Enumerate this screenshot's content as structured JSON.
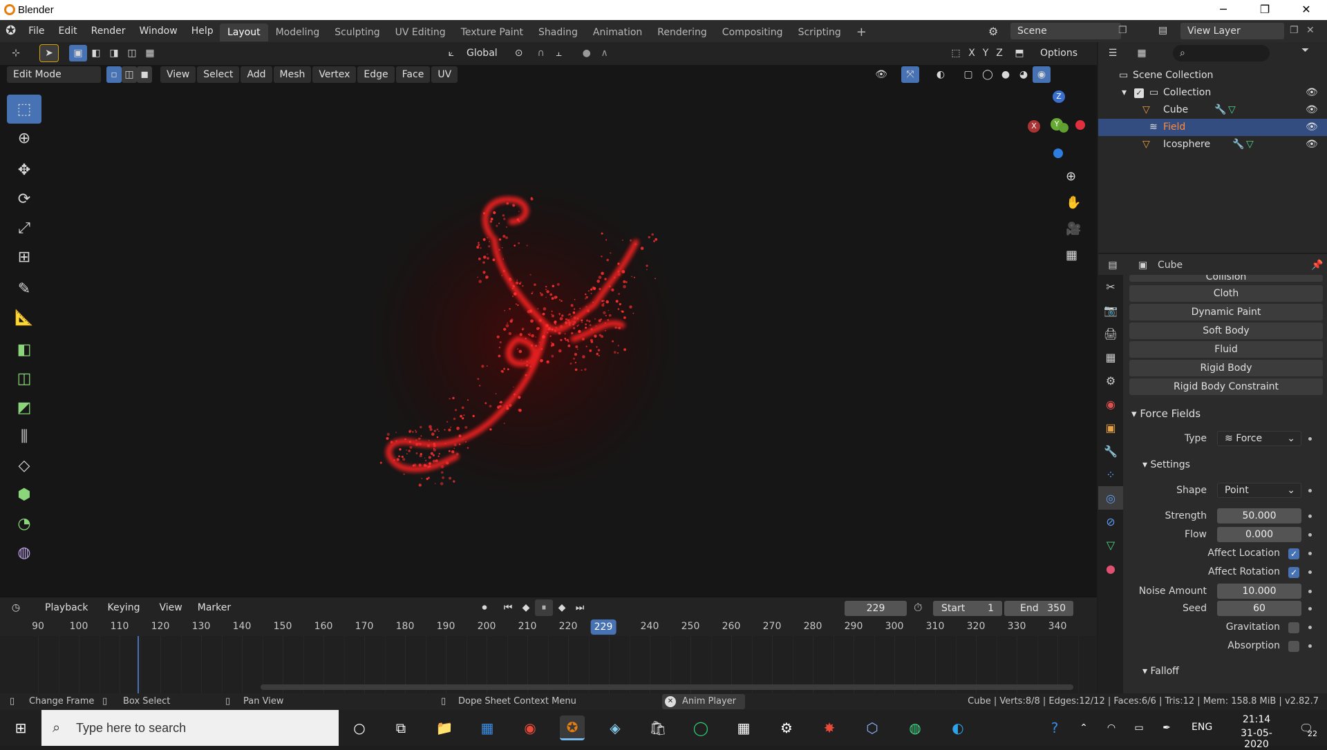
{
  "window": {
    "title": "Blender",
    "controls": [
      "─",
      "❐",
      "✕"
    ]
  },
  "menus": [
    "File",
    "Edit",
    "Render",
    "Window",
    "Help"
  ],
  "workspaces": [
    "Layout",
    "Modeling",
    "Sculpting",
    "UV Editing",
    "Texture Paint",
    "Shading",
    "Animation",
    "Rendering",
    "Compositing",
    "Scripting"
  ],
  "active_workspace": "Layout",
  "add_workspace": "+",
  "scene": "Scene",
  "view_layer": "View Layer",
  "viewport": {
    "orientation": "Global",
    "axes": [
      "X",
      "Y",
      "Z"
    ],
    "options": "Options",
    "mode": "Edit Mode",
    "header_menus": [
      "View",
      "Select",
      "Add",
      "Mesh",
      "Vertex",
      "Edge",
      "Face",
      "UV"
    ],
    "gizmo_axes": {
      "x": "X",
      "y": "Y",
      "z": "Z"
    },
    "particle_color": "#ff1a1a"
  },
  "timeline": {
    "menus": [
      "Playback",
      "Keying",
      "View",
      "Marker"
    ],
    "current_frame": "229",
    "start_label": "Start",
    "start": "1",
    "end_label": "End",
    "end": "350",
    "ticks": [
      "90",
      "100",
      "110",
      "120",
      "130",
      "140",
      "150",
      "160",
      "170",
      "180",
      "190",
      "200",
      "210",
      "220",
      "240",
      "250",
      "260",
      "270",
      "280",
      "290",
      "300",
      "310",
      "320",
      "330",
      "340"
    ]
  },
  "outliner": {
    "root": "Scene Collection",
    "collection": "Collection",
    "items": [
      {
        "name": "Cube",
        "selected": false
      },
      {
        "name": "Field",
        "selected": true
      },
      {
        "name": "Icosphere",
        "selected": false
      }
    ]
  },
  "properties": {
    "object_name": "Cube",
    "partial_button": "Collision",
    "physics_buttons": [
      "Cloth",
      "Dynamic Paint",
      "Soft Body",
      "Fluid",
      "Rigid Body",
      "Rigid Body Constraint"
    ],
    "force_fields": {
      "section": "Force Fields",
      "type_label": "Type",
      "type": "Force",
      "settings_label": "Settings",
      "shape_label": "Shape",
      "shape": "Point",
      "strength_label": "Strength",
      "strength": "50.000",
      "flow_label": "Flow",
      "flow": "0.000",
      "affect_location_label": "Affect Location",
      "affect_location": true,
      "affect_rotation_label": "Affect Rotation",
      "affect_rotation": true,
      "noise_label": "Noise Amount",
      "noise": "10.000",
      "seed_label": "Seed",
      "seed": "60",
      "gravitation_label": "Gravitation",
      "gravitation": false,
      "absorption_label": "Absorption",
      "absorption": false,
      "falloff_label": "Falloff"
    }
  },
  "statusbar": {
    "change_frame": "Change Frame",
    "box_select": "Box Select",
    "pan_view": "Pan View",
    "context_menu": "Dope Sheet Context Menu",
    "anim_player": "Anim Player",
    "stats": "Cube | Verts:8/8 | Edges:12/12 | Faces:6/6 | Tris:12 | Mem: 158.8 MiB | v2.82.7"
  },
  "taskbar": {
    "search_placeholder": "Type here to search",
    "language": "ENG",
    "time": "21:14",
    "date": "31-05-2020",
    "notifications": "22"
  }
}
